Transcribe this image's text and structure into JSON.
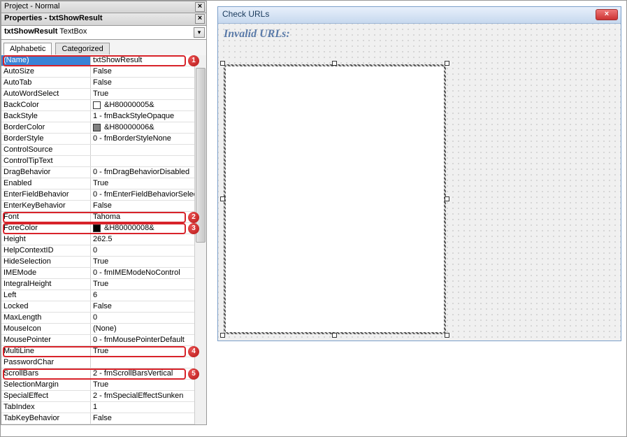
{
  "project": {
    "title": "Project - Normal"
  },
  "properties": {
    "title": "Properties - txtShowResult",
    "object_name": "txtShowResult",
    "object_type": "TextBox",
    "tabs": {
      "alphabetic": "Alphabetic",
      "categorized": "Categorized"
    },
    "rows": [
      {
        "k": "(Name)",
        "v": "txtShowResult",
        "selected": true
      },
      {
        "k": "AutoSize",
        "v": "False"
      },
      {
        "k": "AutoTab",
        "v": "False"
      },
      {
        "k": "AutoWordSelect",
        "v": "True"
      },
      {
        "k": "BackColor",
        "v": "&H80000005&",
        "swatch": "#ffffff"
      },
      {
        "k": "BackStyle",
        "v": "1 - fmBackStyleOpaque"
      },
      {
        "k": "BorderColor",
        "v": "&H80000006&",
        "swatch": "#808080"
      },
      {
        "k": "BorderStyle",
        "v": "0 - fmBorderStyleNone"
      },
      {
        "k": "ControlSource",
        "v": ""
      },
      {
        "k": "ControlTipText",
        "v": ""
      },
      {
        "k": "DragBehavior",
        "v": "0 - fmDragBehaviorDisabled"
      },
      {
        "k": "Enabled",
        "v": "True"
      },
      {
        "k": "EnterFieldBehavior",
        "v": "0 - fmEnterFieldBehaviorSelec"
      },
      {
        "k": "EnterKeyBehavior",
        "v": "False"
      },
      {
        "k": "Font",
        "v": "Tahoma"
      },
      {
        "k": "ForeColor",
        "v": "&H80000008&",
        "swatch": "#000000"
      },
      {
        "k": "Height",
        "v": "262.5"
      },
      {
        "k": "HelpContextID",
        "v": "0"
      },
      {
        "k": "HideSelection",
        "v": "True"
      },
      {
        "k": "IMEMode",
        "v": "0 - fmIMEModeNoControl"
      },
      {
        "k": "IntegralHeight",
        "v": "True"
      },
      {
        "k": "Left",
        "v": "6"
      },
      {
        "k": "Locked",
        "v": "False"
      },
      {
        "k": "MaxLength",
        "v": "0"
      },
      {
        "k": "MouseIcon",
        "v": "(None)"
      },
      {
        "k": "MousePointer",
        "v": "0 - fmMousePointerDefault"
      },
      {
        "k": "MultiLine",
        "v": "True"
      },
      {
        "k": "PasswordChar",
        "v": ""
      },
      {
        "k": "ScrollBars",
        "v": "2 - fmScrollBarsVertical"
      },
      {
        "k": "SelectionMargin",
        "v": "True"
      },
      {
        "k": "SpecialEffect",
        "v": "2 - fmSpecialEffectSunken"
      },
      {
        "k": "TabIndex",
        "v": "1"
      },
      {
        "k": "TabKeyBehavior",
        "v": "False"
      }
    ]
  },
  "annotations": {
    "highlights": [
      {
        "row": 0,
        "badge": "1"
      },
      {
        "row": 14,
        "badge": "2"
      },
      {
        "row": 15,
        "badge": "3"
      },
      {
        "row": 26,
        "badge": "4"
      },
      {
        "row": 28,
        "badge": "5"
      }
    ]
  },
  "form": {
    "title": "Check URLs",
    "label": "Invalid URLs:"
  }
}
